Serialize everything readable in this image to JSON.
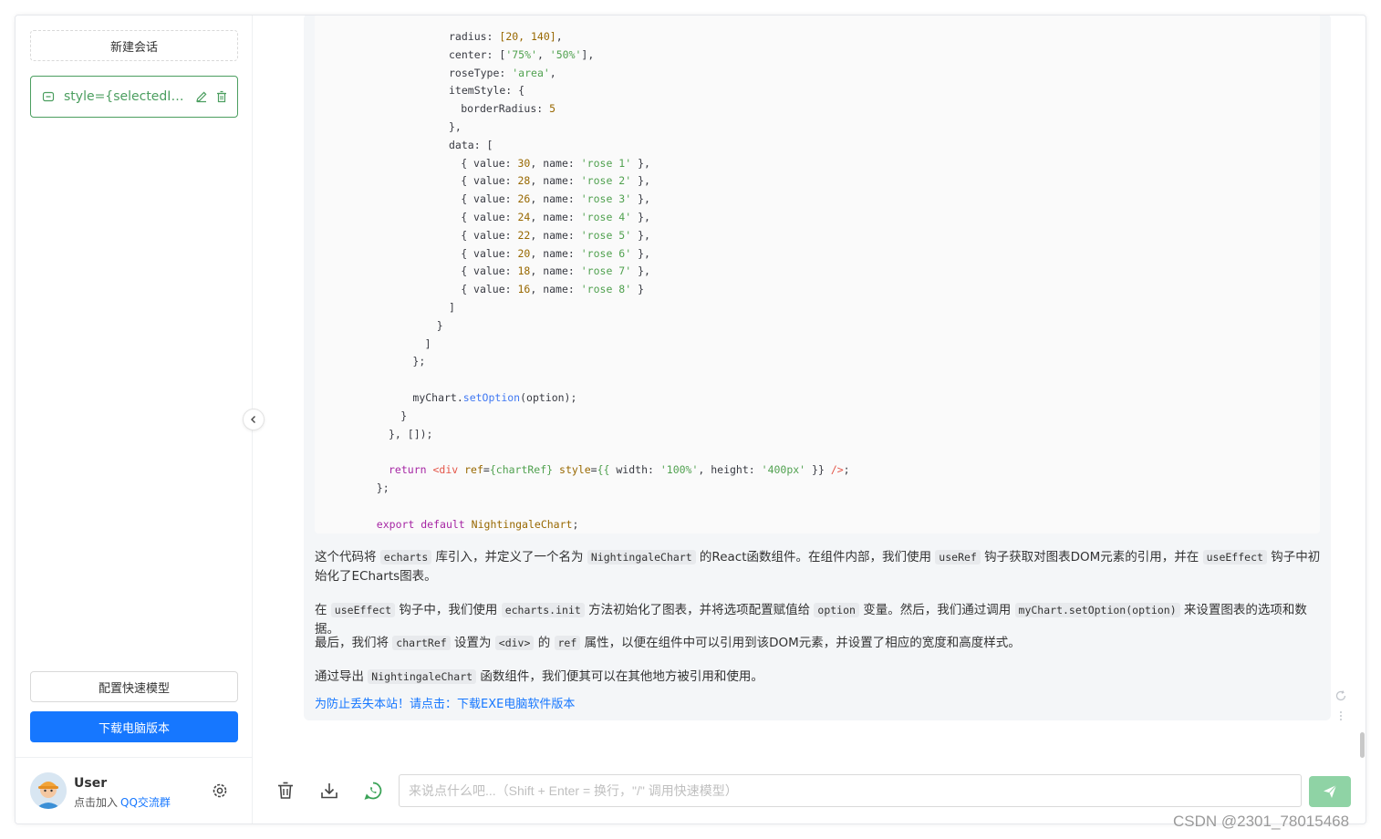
{
  "sidebar": {
    "new_chat_label": "新建会话",
    "conversations": [
      {
        "title": "style={selectedIte..."
      }
    ],
    "config_model_label": "配置快速模型",
    "download_desktop_label": "下载电脑版本"
  },
  "user": {
    "name": "User",
    "join_text": "点击加入",
    "qq_group": "QQ交流群"
  },
  "code_lines": [
    {
      "indent": 20,
      "parts": [
        [
          "",
          "radius: "
        ],
        [
          "n",
          "[20, 140]"
        ],
        [
          "",
          ","
        ]
      ]
    },
    {
      "indent": 20,
      "parts": [
        [
          "",
          "center: ["
        ],
        [
          "s",
          "'75%'"
        ],
        [
          "",
          ", "
        ],
        [
          "s",
          "'50%'"
        ],
        [
          "",
          "],"
        ]
      ]
    },
    {
      "indent": 20,
      "parts": [
        [
          "",
          "roseType: "
        ],
        [
          "s",
          "'area'"
        ],
        [
          "",
          ","
        ]
      ]
    },
    {
      "indent": 20,
      "parts": [
        [
          "",
          "itemStyle: {"
        ]
      ]
    },
    {
      "indent": 22,
      "parts": [
        [
          "",
          "borderRadius: "
        ],
        [
          "n",
          "5"
        ]
      ]
    },
    {
      "indent": 20,
      "parts": [
        [
          "",
          "},"
        ]
      ]
    },
    {
      "indent": 20,
      "parts": [
        [
          "",
          "data: ["
        ]
      ]
    },
    {
      "indent": 22,
      "parts": [
        [
          "",
          "{ value: "
        ],
        [
          "n",
          "30"
        ],
        [
          "",
          ", name: "
        ],
        [
          "s",
          "'rose 1'"
        ],
        [
          "",
          " },"
        ]
      ]
    },
    {
      "indent": 22,
      "parts": [
        [
          "",
          "{ value: "
        ],
        [
          "n",
          "28"
        ],
        [
          "",
          ", name: "
        ],
        [
          "s",
          "'rose 2'"
        ],
        [
          "",
          " },"
        ]
      ]
    },
    {
      "indent": 22,
      "parts": [
        [
          "",
          "{ value: "
        ],
        [
          "n",
          "26"
        ],
        [
          "",
          ", name: "
        ],
        [
          "s",
          "'rose 3'"
        ],
        [
          "",
          " },"
        ]
      ]
    },
    {
      "indent": 22,
      "parts": [
        [
          "",
          "{ value: "
        ],
        [
          "n",
          "24"
        ],
        [
          "",
          ", name: "
        ],
        [
          "s",
          "'rose 4'"
        ],
        [
          "",
          " },"
        ]
      ]
    },
    {
      "indent": 22,
      "parts": [
        [
          "",
          "{ value: "
        ],
        [
          "n",
          "22"
        ],
        [
          "",
          ", name: "
        ],
        [
          "s",
          "'rose 5'"
        ],
        [
          "",
          " },"
        ]
      ]
    },
    {
      "indent": 22,
      "parts": [
        [
          "",
          "{ value: "
        ],
        [
          "n",
          "20"
        ],
        [
          "",
          ", name: "
        ],
        [
          "s",
          "'rose 6'"
        ],
        [
          "",
          " },"
        ]
      ]
    },
    {
      "indent": 22,
      "parts": [
        [
          "",
          "{ value: "
        ],
        [
          "n",
          "18"
        ],
        [
          "",
          ", name: "
        ],
        [
          "s",
          "'rose 7'"
        ],
        [
          "",
          " },"
        ]
      ]
    },
    {
      "indent": 22,
      "parts": [
        [
          "",
          "{ value: "
        ],
        [
          "n",
          "16"
        ],
        [
          "",
          ", name: "
        ],
        [
          "s",
          "'rose 8'"
        ],
        [
          "",
          " }"
        ]
      ]
    },
    {
      "indent": 20,
      "parts": [
        [
          "",
          "]"
        ]
      ]
    },
    {
      "indent": 18,
      "parts": [
        [
          "",
          "}"
        ]
      ]
    },
    {
      "indent": 16,
      "parts": [
        [
          "",
          "]"
        ]
      ]
    },
    {
      "indent": 14,
      "parts": [
        [
          "",
          "};"
        ]
      ]
    },
    {
      "indent": 0,
      "parts": []
    },
    {
      "indent": 14,
      "parts": [
        [
          "",
          "myChart."
        ],
        [
          "f",
          "setOption"
        ],
        [
          "",
          "(option);"
        ]
      ]
    },
    {
      "indent": 12,
      "parts": [
        [
          "",
          "}"
        ]
      ]
    },
    {
      "indent": 10,
      "parts": [
        [
          "",
          "}, []);"
        ]
      ]
    },
    {
      "indent": 0,
      "parts": []
    },
    {
      "indent": 10,
      "parts": [
        [
          "k",
          "return"
        ],
        [
          "",
          " "
        ],
        [
          "t",
          "<div"
        ],
        [
          "",
          " "
        ],
        [
          "p",
          "ref"
        ],
        [
          "",
          "="
        ],
        [
          "s",
          "{chartRef}"
        ],
        [
          "",
          " "
        ],
        [
          "p",
          "style"
        ],
        [
          "",
          "="
        ],
        [
          "s",
          "{{"
        ],
        [
          "",
          " width: "
        ],
        [
          "s",
          "'100%'"
        ],
        [
          "",
          ", height: "
        ],
        [
          "s",
          "'400px'"
        ],
        [
          "",
          " }} "
        ],
        [
          "t",
          "/>"
        ],
        [
          "",
          ";"
        ]
      ]
    },
    {
      "indent": 8,
      "parts": [
        [
          "",
          "};"
        ]
      ]
    },
    {
      "indent": 0,
      "parts": []
    },
    {
      "indent": 8,
      "parts": [
        [
          "k",
          "export default"
        ],
        [
          "",
          " "
        ],
        [
          "n",
          "NightingaleChart"
        ],
        [
          "",
          ";"
        ]
      ]
    }
  ],
  "paragraphs": [
    [
      [
        "t",
        "这个代码将 "
      ],
      [
        "c",
        "echarts"
      ],
      [
        "t",
        " 库引入，并定义了一个名为 "
      ],
      [
        "c",
        "NightingaleChart"
      ],
      [
        "t",
        " 的React函数组件。在组件内部，我们使用 "
      ],
      [
        "c",
        "useRef"
      ],
      [
        "t",
        " 钩子获取对图表DOM元素的引用，并在 "
      ],
      [
        "c",
        "useEffect"
      ],
      [
        "t",
        " 钩子中初始化了ECharts图表。"
      ]
    ],
    [
      [
        "t",
        "在 "
      ],
      [
        "c",
        "useEffect"
      ],
      [
        "t",
        " 钩子中，我们使用 "
      ],
      [
        "c",
        "echarts.init"
      ],
      [
        "t",
        " 方法初始化了图表，并将选项配置赋值给 "
      ],
      [
        "c",
        "option"
      ],
      [
        "t",
        " 变量。然后，我们通过调用 "
      ],
      [
        "c",
        "myChart.setOption(option)"
      ],
      [
        "t",
        " 来设置图表的选项和数据。"
      ]
    ],
    [
      [
        "t",
        "最后，我们将 "
      ],
      [
        "c",
        "chartRef"
      ],
      [
        "t",
        " 设置为 "
      ],
      [
        "c",
        "<div>"
      ],
      [
        "t",
        " 的 "
      ],
      [
        "c",
        "ref"
      ],
      [
        "t",
        " 属性，以便在组件中可以引用到该DOM元素，并设置了相应的宽度和高度样式。"
      ]
    ],
    [
      [
        "t",
        "通过导出 "
      ],
      [
        "c",
        "NightingaleChart"
      ],
      [
        "t",
        " 函数组件，我们便其可以在其他地方被引用和使用。"
      ]
    ]
  ],
  "download_link_text": "为防止丢失本站！请点击：下载EXE电脑软件版本",
  "composer": {
    "placeholder": "来说点什么吧...（Shift + Enter = 换行，\"/\" 调用快速模型）"
  },
  "watermark": "CSDN @2301_78015468",
  "colors": {
    "accent_green": "#4b9e5f",
    "primary_blue": "#1677ff",
    "send_green": "#8fd3a5"
  }
}
